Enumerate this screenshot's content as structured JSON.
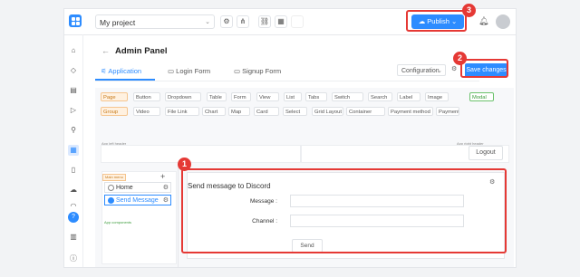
{
  "topbar": {
    "project_name": "My project",
    "publish_label": "Publish"
  },
  "page": {
    "title": "Admin Panel",
    "tabs": [
      {
        "label": "Application",
        "active": true
      },
      {
        "label": "Login Form",
        "active": false
      },
      {
        "label": "Signup Form",
        "active": false
      }
    ],
    "configuration_label": "Configuration",
    "save_label": "Save changes"
  },
  "components": {
    "row1": [
      "Page",
      "Button",
      "Dropdown",
      "Table",
      "Form",
      "View",
      "List",
      "Tabs",
      "Switch",
      "Search",
      "Label",
      "Image"
    ],
    "row1_extra": "Modal",
    "row2": [
      "Group",
      "Video",
      "File Link",
      "Chart",
      "Map",
      "Card",
      "Select",
      "Grid Layout",
      "Container",
      "Payment method",
      "Payment"
    ]
  },
  "layout": {
    "header_left_label": "App left header",
    "header_right_label": "App right header",
    "logout_label": "Logout",
    "menu_badge": "Main menu",
    "menu_items": [
      {
        "label": "Home",
        "active": false
      },
      {
        "label": "Send Message",
        "active": true
      }
    ],
    "app_components_label": "App components"
  },
  "form": {
    "title": "Send message to Discord",
    "fields": [
      {
        "label": "Message :"
      },
      {
        "label": "Channel :"
      }
    ],
    "send_label": "Send"
  },
  "annotations": {
    "badge1": "1",
    "badge2": "2",
    "badge3": "3"
  },
  "colors": {
    "accent": "#2d8cff",
    "highlight": "#e53935"
  }
}
